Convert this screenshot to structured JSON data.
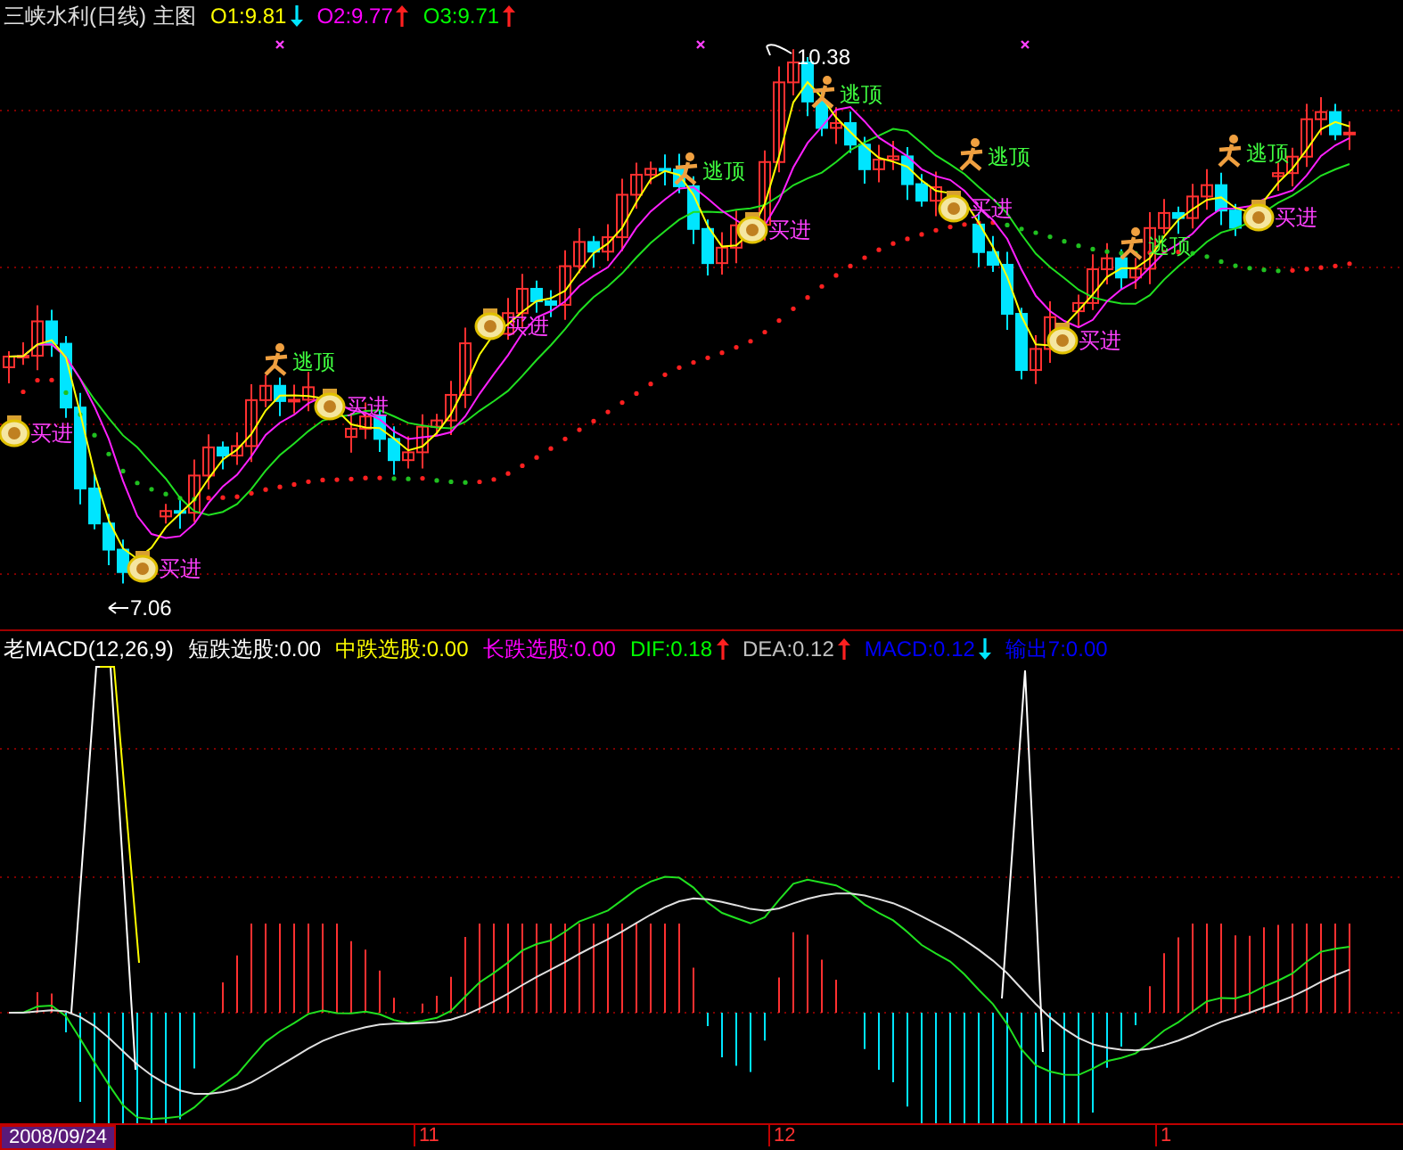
{
  "header": {
    "title": "三峡水利(日线)",
    "chart_label": "主图",
    "indicators": [
      {
        "label": "O1:9.81",
        "color": "#ffff00",
        "rising": false
      },
      {
        "label": "O2:9.77",
        "color": "#ff00ff",
        "rising": true
      },
      {
        "label": "O3:9.71",
        "color": "#00ff00",
        "rising": true
      }
    ]
  },
  "price_labels": {
    "high": "10.38",
    "low": "7.06"
  },
  "signals": [
    {
      "kind": "buy",
      "text": "买进"
    },
    {
      "kind": "escape",
      "text": "逃顶"
    },
    {
      "kind": "buy",
      "text": "买进"
    },
    {
      "kind": "buy",
      "text": "买进"
    },
    {
      "kind": "buy",
      "text": "买进"
    },
    {
      "kind": "escape",
      "text": "逃顶"
    },
    {
      "kind": "buy",
      "text": "买进"
    },
    {
      "kind": "escape",
      "text": "逃顶"
    },
    {
      "kind": "escape",
      "text": "逃顶"
    },
    {
      "kind": "buy",
      "text": "买进"
    },
    {
      "kind": "buy",
      "text": "买进"
    },
    {
      "kind": "escape",
      "text": "逃顶"
    },
    {
      "kind": "escape",
      "text": "逃顶"
    },
    {
      "kind": "buy",
      "text": "买进"
    }
  ],
  "macd_header": {
    "name": "老MACD(12,26,9)",
    "values": [
      {
        "label": "短跌选股:0.00",
        "color": "#ffffff"
      },
      {
        "label": "中跌选股:0.00",
        "color": "#ffff00"
      },
      {
        "label": "长跌选股:0.00",
        "color": "#ff00ff"
      },
      {
        "label": "DIF:0.18",
        "color": "#00ff00",
        "rising": true
      },
      {
        "label": "DEA:0.12",
        "color": "#c0c0c0",
        "rising": true
      },
      {
        "label": "MACD:0.12",
        "color": "#0000ff",
        "rising": false
      },
      {
        "label": "输出7:0.00",
        "color": "#0000ff"
      }
    ]
  },
  "axis": {
    "date": "2008/09/24",
    "ticks": [
      "11",
      "12",
      "1"
    ]
  }
}
